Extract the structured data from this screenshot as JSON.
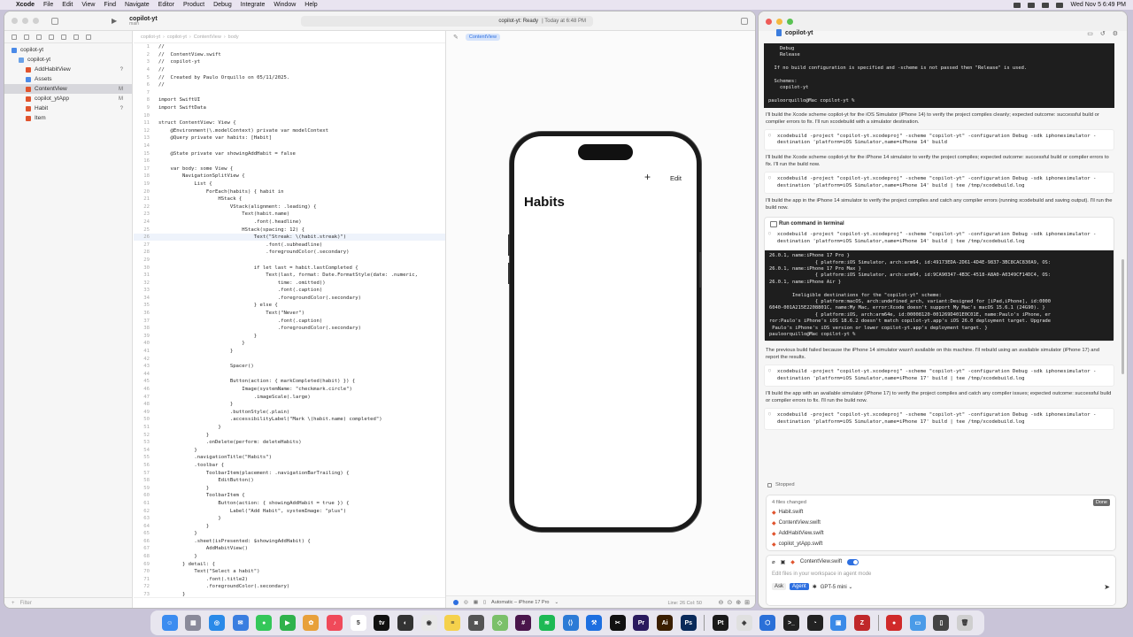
{
  "menubar": {
    "app": "Xcode",
    "items": [
      "File",
      "Edit",
      "View",
      "Find",
      "Navigate",
      "Editor",
      "Product",
      "Debug",
      "Integrate",
      "Window",
      "Help"
    ],
    "clock": "Wed Nov 5  6:49 PM"
  },
  "xcode": {
    "project_name": "copilot-yt",
    "branch": "main",
    "status_project": "copilot-yt: Ready",
    "status_time": "Today at 6:48 PM",
    "navigator": {
      "items": [
        {
          "label": "copilot-yt",
          "indent": 0,
          "icon": "project",
          "badge": ""
        },
        {
          "label": "copilot-yt",
          "indent": 1,
          "icon": "folder",
          "badge": ""
        },
        {
          "label": "AddHabitView",
          "indent": 2,
          "icon": "swift",
          "badge": "?"
        },
        {
          "label": "Assets",
          "indent": 2,
          "icon": "assets",
          "badge": ""
        },
        {
          "label": "ContentView",
          "indent": 2,
          "icon": "swift",
          "badge": "M",
          "selected": true
        },
        {
          "label": "copilot_ytApp",
          "indent": 2,
          "icon": "swift",
          "badge": "M"
        },
        {
          "label": "Habit",
          "indent": 2,
          "icon": "swift",
          "badge": "?"
        },
        {
          "label": "Item",
          "indent": 2,
          "icon": "swift",
          "badge": ""
        }
      ],
      "filter_placeholder": "Filter"
    },
    "jumpbar": [
      "copilot-yt",
      "copilot-yt",
      "ContentView",
      "body"
    ],
    "code": [
      {
        "n": 1,
        "t": "//"
      },
      {
        "n": 2,
        "t": "//  ContentView.swift"
      },
      {
        "n": 3,
        "t": "//  copilot-yt"
      },
      {
        "n": 4,
        "t": "//"
      },
      {
        "n": 5,
        "t": "//  Created by Paulo Orquillo on 05/11/2025."
      },
      {
        "n": 6,
        "t": "//"
      },
      {
        "n": 7,
        "t": ""
      },
      {
        "n": 8,
        "t": "import SwiftUI"
      },
      {
        "n": 9,
        "t": "import SwiftData"
      },
      {
        "n": 10,
        "t": ""
      },
      {
        "n": 11,
        "t": "struct ContentView: View {"
      },
      {
        "n": 12,
        "t": "    @Environment(\\.modelContext) private var modelContext",
        "mod": true
      },
      {
        "n": 13,
        "t": "    @Query private var habits: [Habit]",
        "mod": true
      },
      {
        "n": 14,
        "t": "",
        "mod": true
      },
      {
        "n": 15,
        "t": "    @State private var showingAddHabit = false",
        "mod": true
      },
      {
        "n": 16,
        "t": "",
        "mod": true
      },
      {
        "n": 17,
        "t": "    var body: some View {"
      },
      {
        "n": 18,
        "t": "        NavigationSplitView {"
      },
      {
        "n": 19,
        "t": "            List {"
      },
      {
        "n": 20,
        "t": "                ForEach(habits) { habit in",
        "mod": true
      },
      {
        "n": 21,
        "t": "                    HStack {",
        "mod": true
      },
      {
        "n": 22,
        "t": "                        VStack(alignment: .leading) {",
        "mod": true
      },
      {
        "n": 23,
        "t": "                            Text(habit.name)",
        "mod": true
      },
      {
        "n": 24,
        "t": "                                .font(.headline)",
        "mod": true
      },
      {
        "n": 25,
        "t": "                            HStack(spacing: 12) {",
        "mod": true
      },
      {
        "n": 26,
        "t": "                                Text(\"Streak: \\(habit.streak)\")",
        "mod": true,
        "cur": true
      },
      {
        "n": 27,
        "t": "                                    .font(.subheadline)",
        "mod": true
      },
      {
        "n": 28,
        "t": "                                    .foregroundColor(.secondary)",
        "mod": true
      },
      {
        "n": 29,
        "t": "",
        "mod": true
      },
      {
        "n": 30,
        "t": "                                if let last = habit.lastCompleted {",
        "mod": true
      },
      {
        "n": 31,
        "t": "                                    Text(last, format: Date.FormatStyle(date: .numeric,",
        "mod": true
      },
      {
        "n": 32,
        "t": "                                        time: .omitted))",
        "mod": true
      },
      {
        "n": 33,
        "t": "                                        .font(.caption)",
        "mod": true
      },
      {
        "n": 34,
        "t": "                                        .foregroundColor(.secondary)",
        "mod": true
      },
      {
        "n": 35,
        "t": "                                } else {",
        "mod": true
      },
      {
        "n": 36,
        "t": "                                    Text(\"Never\")",
        "mod": true
      },
      {
        "n": 37,
        "t": "                                        .font(.caption)",
        "mod": true
      },
      {
        "n": 38,
        "t": "                                        .foregroundColor(.secondary)",
        "mod": true
      },
      {
        "n": 39,
        "t": "                                }",
        "mod": true
      },
      {
        "n": 40,
        "t": "                            }",
        "mod": true
      },
      {
        "n": 41,
        "t": "                        }",
        "mod": true
      },
      {
        "n": 42,
        "t": "",
        "mod": true
      },
      {
        "n": 43,
        "t": "                        Spacer()",
        "mod": true
      },
      {
        "n": 44,
        "t": "",
        "mod": true
      },
      {
        "n": 45,
        "t": "                        Button(action: { markCompleted(habit) }) {",
        "mod": true
      },
      {
        "n": 46,
        "t": "                            Image(systemName: \"checkmark.circle\")",
        "mod": true
      },
      {
        "n": 47,
        "t": "                                .imageScale(.large)",
        "mod": true
      },
      {
        "n": 48,
        "t": "                        }",
        "mod": true
      },
      {
        "n": 49,
        "t": "                        .buttonStyle(.plain)",
        "mod": true
      },
      {
        "n": 50,
        "t": "                        .accessibilityLabel(\"Mark \\(habit.name) completed\")",
        "mod": true
      },
      {
        "n": 51,
        "t": "                    }",
        "mod": true
      },
      {
        "n": 52,
        "t": "                }",
        "mod": true
      },
      {
        "n": 53,
        "t": "                .onDelete(perform: deleteHabits)",
        "mod": true
      },
      {
        "n": 54,
        "t": "            }"
      },
      {
        "n": 55,
        "t": "            .navigationTitle(\"Habits\")",
        "mod": true
      },
      {
        "n": 56,
        "t": "            .toolbar {"
      },
      {
        "n": 57,
        "t": "                ToolbarItem(placement: .navigationBarTrailing) {"
      },
      {
        "n": 58,
        "t": "                    EditButton()"
      },
      {
        "n": 59,
        "t": "                }"
      },
      {
        "n": 60,
        "t": "                ToolbarItem {"
      },
      {
        "n": 61,
        "t": "                    Button(action: { showingAddHabit = true }) {",
        "mod": true
      },
      {
        "n": 62,
        "t": "                        Label(\"Add Habit\", systemImage: \"plus\")",
        "mod": true
      },
      {
        "n": 63,
        "t": "                    }"
      },
      {
        "n": 64,
        "t": "                }"
      },
      {
        "n": 65,
        "t": "            }"
      },
      {
        "n": 66,
        "t": "            .sheet(isPresented: $showingAddHabit) {",
        "mod": true
      },
      {
        "n": 67,
        "t": "                AddHabitView()",
        "mod": true
      },
      {
        "n": 68,
        "t": "            }",
        "mod": true
      },
      {
        "n": 69,
        "t": "        } detail: {"
      },
      {
        "n": 70,
        "t": "            Text(\"Select a habit\")",
        "mod": true
      },
      {
        "n": 71,
        "t": "                .font(.title2)",
        "mod": true
      },
      {
        "n": 72,
        "t": "                .foregroundColor(.secondary)",
        "mod": true
      },
      {
        "n": 73,
        "t": "        }"
      }
    ],
    "cursor_position": "Line: 26  Col: 50",
    "canvas": {
      "tab_label": "ContentView",
      "device": "Automatic – iPhone 17 Pro",
      "preview": {
        "plus_label": "+",
        "edit_label": "Edit",
        "title": "Habits"
      }
    }
  },
  "copilot": {
    "title": "copilot-yt",
    "blocks": [
      {
        "kind": "term",
        "text": "    Debug\n    Release\n\n  If no build configuration is specified and -scheme is not passed then \"Release\" is used.\n\n  Schemes:\n    copilot-yt\n\npauloorquillo@Mac copilot-yt %"
      },
      {
        "kind": "msg",
        "text": "I'll build the Xcode scheme copilot-yt for the iOS Simulator (iPhone 14) to verify the project compiles cleanly; expected outcome: successful build or compiler errors to fix. I'll run xcodebuild with a simulator destination."
      },
      {
        "kind": "cmd",
        "text": "xcodebuild -project \"copilot-yt.xcodeproj\" -scheme \"copilot-yt\" -configuration Debug -sdk iphonesimulator -destination 'platform=iOS Simulator,name=iPhone 14' build"
      },
      {
        "kind": "msg",
        "text": "I'll build the Xcode scheme copilot-yt for the iPhone 14 simulator to verify the project compiles; expected outcome: successful build or compiler errors to fix. I'll run the build now."
      },
      {
        "kind": "cmd",
        "text": "xcodebuild -project \"copilot-yt.xcodeproj\" -scheme \"copilot-yt\" -configuration Debug -sdk iphonesimulator -destination 'platform=iOS Simulator,name=iPhone 14' build | tee /tmp/xcodebuild.log"
      },
      {
        "kind": "msg",
        "text": "I'll build the app in the iPhone 14 simulator to verify the project compiles and catch any compiler errors (running xcodebuild and saving output). I'll run the build now."
      }
    ],
    "run_card": {
      "title": "Run command in terminal",
      "command": "xcodebuild -project \"copilot-yt.xcodeproj\" -scheme \"copilot-yt\" -configuration Debug -sdk iphonesimulator -destination 'platform=iOS Simulator,name=iPhone 14' build | tee /tmp/xcodebuild.log",
      "output": "26.0.1, name:iPhone 17 Pro }\n                { platform:iOS Simulator, arch:arm64, id:49173EDA-2D61-4D4E-9837-3BC8CAC830A9, OS:\n26.0.1, name:iPhone 17 Pro Max }\n                { platform:iOS Simulator, arch:arm64, id:9CA90347-4B3C-4518-A8A0-A0349CF14DC4, OS:\n26.0.1, name:iPhone Air }\n\n        Ineligible destinations for the \"copilot-yt\" scheme:\n                { platform:macOS, arch:undefined_arch, variant:Designed for [iPad,iPhone], id:0000\n6040-001A215E2208801C, name:My Mac, error:Xcode doesn't support My Mac's macOS 15.6.1 (24G90). }\n                { platform:iOS, arch:arm64e, id:00008120-001269D401E0C01E, name:Paulo's iPhone, er\nror:Paulo's iPhone's iOS 18.6.2 doesn't match copilot-yt.app's iOS 26.0 deployment target. Upgrade\n Paulo's iPhone's iOS version or lower copilot-yt.app's deployment target. }\npauloorquillo@Mac copilot-yt %"
    },
    "blocks_after": [
      {
        "kind": "msg",
        "text": "The previous build failed because the iPhone 14 simulator wasn't available on this machine. I'll rebuild using an available simulator (iPhone 17) and report the results."
      },
      {
        "kind": "cmd",
        "text": "xcodebuild -project \"copilot-yt.xcodeproj\" -scheme \"copilot-yt\" -configuration Debug -sdk iphonesimulator -destination 'platform=iOS Simulator,name=iPhone 17' build | tee /tmp/xcodebuild.log"
      },
      {
        "kind": "msg",
        "text": "I'll build the app with an available simulator (iPhone 17) to verify the project compiles and catch any compiler issues; expected outcome: successful build or compiler errors to fix. I'll run the build now."
      },
      {
        "kind": "cmd",
        "text": "xcodebuild -project \"copilot-yt.xcodeproj\" -scheme \"copilot-yt\" -configuration Debug -sdk iphonesimulator -destination 'platform=iOS Simulator,name=iPhone 17' build | tee /tmp/xcodebuild.log"
      }
    ],
    "stopped_label": "Stopped",
    "changes": {
      "title": "4 files changed",
      "done_label": "Done",
      "files": [
        "Habit.swift",
        "ContentView.swift",
        "AddHabitView.swift",
        "copilot_ytApp.swift"
      ]
    },
    "input": {
      "attached_file": "ContentView.swift",
      "placeholder": "Edit files in your workspace in agent mode",
      "ask_label": "Ask",
      "agent_label": "Agent",
      "model": "GPT-5 mini ⌄"
    }
  },
  "dock": {
    "icons": [
      {
        "name": "finder",
        "color": "#3b8cf0",
        "glyph": "☺"
      },
      {
        "name": "launchpad",
        "color": "#8a8a9a",
        "glyph": "▦"
      },
      {
        "name": "safari",
        "color": "#2a8ae8",
        "glyph": "◎"
      },
      {
        "name": "mail",
        "color": "#3a7ee0",
        "glyph": "✉"
      },
      {
        "name": "messages",
        "color": "#34c759",
        "glyph": "●"
      },
      {
        "name": "facetime",
        "color": "#2fb24c",
        "glyph": "▶"
      },
      {
        "name": "photos",
        "color": "#e8a03a",
        "glyph": "✿"
      },
      {
        "name": "music",
        "color": "#f04a5a",
        "glyph": "♪"
      },
      {
        "name": "calendar",
        "color": "#ffffff",
        "glyph": "5"
      },
      {
        "name": "appletv",
        "color": "#111111",
        "glyph": "tv"
      },
      {
        "name": "chatgpt",
        "color": "#333333",
        "glyph": "◐"
      },
      {
        "name": "chrome",
        "color": "#e8e8e8",
        "glyph": "◉"
      },
      {
        "name": "notes",
        "color": "#f5d14c",
        "glyph": "≡"
      },
      {
        "name": "screen",
        "color": "#555555",
        "glyph": "◙"
      },
      {
        "name": "maps",
        "color": "#7bc06a",
        "glyph": "◇"
      },
      {
        "name": "slack",
        "color": "#4a154b",
        "glyph": "#"
      },
      {
        "name": "spotify",
        "color": "#1db954",
        "glyph": "≋"
      },
      {
        "name": "vscode",
        "color": "#2c7bd6",
        "glyph": "⟨⟩"
      },
      {
        "name": "xcode",
        "color": "#1d6fe0",
        "glyph": "⚒"
      },
      {
        "name": "capcut",
        "color": "#111111",
        "glyph": "✂"
      },
      {
        "name": "premiere",
        "color": "#2a1a5e",
        "glyph": "Pr"
      },
      {
        "name": "illustrator",
        "color": "#3a1e00",
        "glyph": "Ai"
      },
      {
        "name": "photoshop",
        "color": "#0a2a5a",
        "glyph": "Ps"
      },
      {
        "name": "pt",
        "color": "#1a1a1a",
        "glyph": "Pt"
      },
      {
        "name": "sequel",
        "color": "#e0e0e0",
        "glyph": "◈"
      },
      {
        "name": "box3d",
        "color": "#2a70d8",
        "glyph": "⬡"
      },
      {
        "name": "terminal",
        "color": "#222222",
        "glyph": ">_"
      },
      {
        "name": "github",
        "color": "#222222",
        "glyph": "◔"
      },
      {
        "name": "simulator",
        "color": "#3a8ae8",
        "glyph": "▣"
      },
      {
        "name": "filezilla",
        "color": "#c0282a",
        "glyph": "Z"
      },
      {
        "name": "media",
        "color": "#d02a2a",
        "glyph": "●"
      },
      {
        "name": "folder",
        "color": "#4a9be8",
        "glyph": "▭"
      },
      {
        "name": "phone-mirror",
        "color": "#444444",
        "glyph": "▯"
      },
      {
        "name": "trash",
        "color": "#cfcfcf",
        "glyph": "🗑"
      }
    ]
  }
}
